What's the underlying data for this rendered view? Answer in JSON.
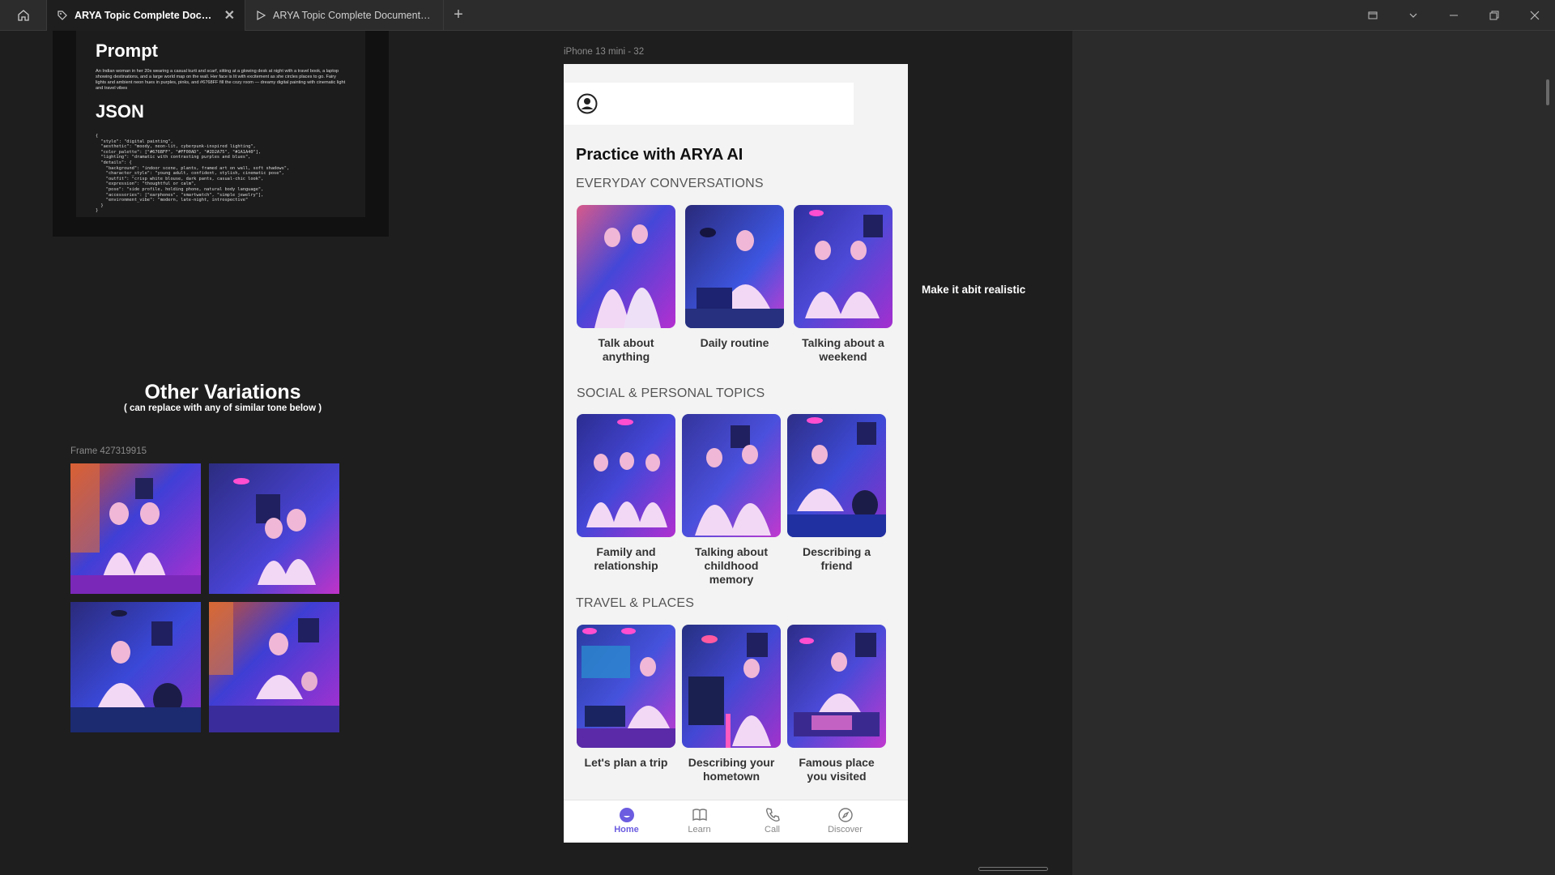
{
  "tabs": [
    {
      "label": "ARYA Topic Complete Documented Flow",
      "active": true
    },
    {
      "label": "ARYA Topic Complete Documented Flow",
      "active": false
    }
  ],
  "prompt_card": {
    "prompt_heading": "Prompt",
    "prompt_text": "An Indian woman in her 20s wearing a casual kurti and scarf, sitting at a glowing desk at night with a travel book, a laptop showing destinations, and a large world map on the wall. Her face is lit with excitement as she circles places to go. Fairy lights and ambient neon hues in purples, pinks, and #6768FF fill the cozy room — dreamy digital painting with cinematic light and travel vibes",
    "json_heading": "JSON",
    "json_text": "{\n  \"style\": \"digital painting\",\n  \"aesthetic\": \"moody, neon-lit, cyberpunk-inspired lighting\",\n  \"color_palette\": [\"#676BFF\", \"#FF00AD\", \"#2D2A75\", \"#1A1A40\"],\n  \"lighting\": \"dramatic with contrasting purples and blues\",\n  \"details\": {\n    \"background\": \"indoor scene, plants, framed art on wall, soft shadows\",\n    \"character_style\": \"young adult, confident, stylish, cinematic pose\",\n    \"outfit\": \"crisp white blouse, dark pants, casual-chic look\",\n    \"expression\": \"thoughtful or calm\",\n    \"pose\": \"side profile, holding phone, natural body language\",\n    \"accessories\": [\"earphones\", \"smartwatch\", \"simple jewelry\"],\n    \"environment_vibe\": \"modern, late-night, introspective\"\n  }\n}"
  },
  "variations": {
    "title": "Other Variations",
    "subtitle": "( can replace with any of similar tone below )",
    "frame_label": "Frame 427319915"
  },
  "phone": {
    "frame_label": "iPhone 13 mini - 32",
    "heading": "Practice with ARYA AI",
    "sections": [
      {
        "title": "EVERYDAY CONVERSATIONS",
        "cards": [
          "Talk about anything",
          "Daily routine",
          "Talking about a weekend"
        ]
      },
      {
        "title": "SOCIAL & PERSONAL TOPICS",
        "cards": [
          "Family and relationship",
          "Talking about childhood memory",
          "Describing a friend"
        ]
      },
      {
        "title": "TRAVEL & PLACES",
        "cards": [
          "Let's plan a trip",
          "Describing your hometown",
          "Famous place you visited"
        ]
      }
    ],
    "nav": [
      "Home",
      "Learn",
      "Call",
      "Discover"
    ],
    "active_nav": "Home"
  },
  "comment": "Make it abit realistic",
  "colors": {
    "accent": "#6b5ce0",
    "neon_pink": "#ff3fc8",
    "neon_blue": "#3b3fd8"
  }
}
